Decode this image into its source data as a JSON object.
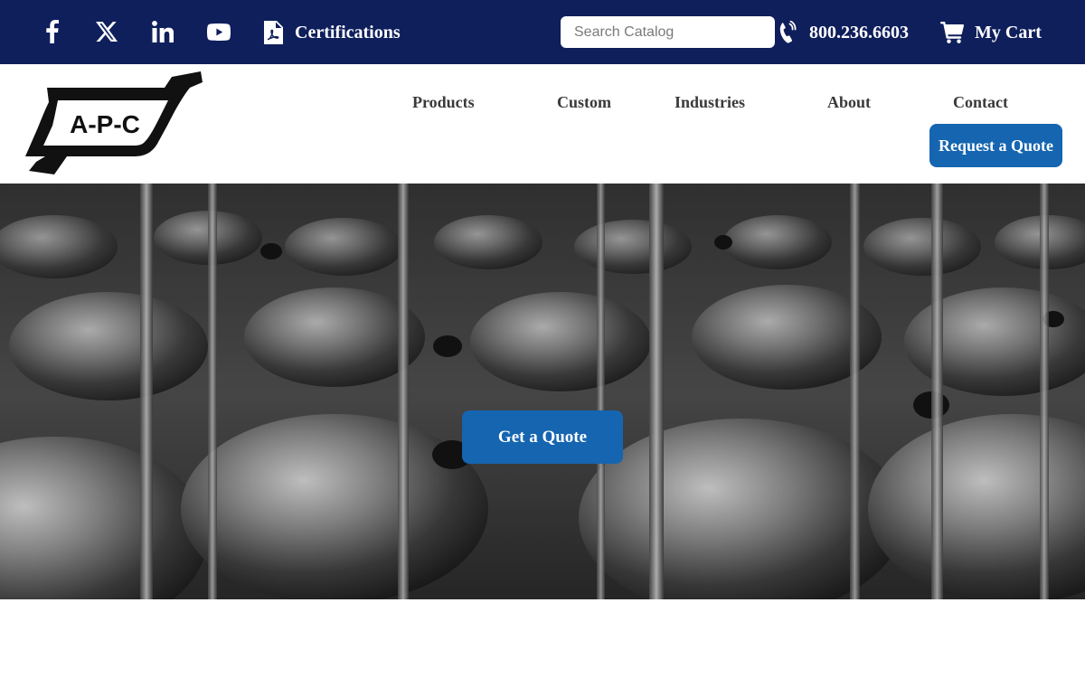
{
  "topbar": {
    "social": [
      {
        "name": "facebook-icon"
      },
      {
        "name": "x-twitter-icon"
      },
      {
        "name": "linkedin-icon"
      },
      {
        "name": "youtube-icon"
      }
    ],
    "certifications_label": "Certifications",
    "certifications_icon": "pdf-file-icon",
    "search_placeholder": "Search Catalog",
    "phone": "800.236.6603",
    "phone_icon": "phone-icon",
    "cart_label": "My Cart",
    "cart_icon": "shopping-cart-icon",
    "background_color": "#0f1f5c"
  },
  "header": {
    "logo_text": "A-P-C",
    "nav": {
      "products": "Products",
      "custom": "Custom",
      "industries": "Industries",
      "about": "About",
      "contact": "Contact"
    },
    "request_quote": "Request a Quote"
  },
  "hero": {
    "button_label": "Get a Quote"
  },
  "colors": {
    "accent": "#1565b0",
    "navy": "#0f1f5c",
    "nav_text": "#3a3a3a"
  }
}
